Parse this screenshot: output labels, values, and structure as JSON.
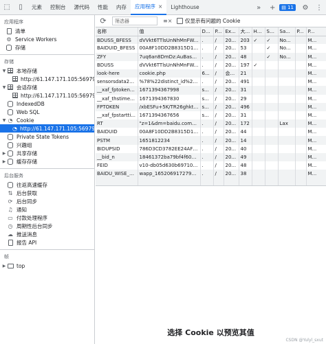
{
  "tabs": [
    {
      "label": "元素"
    },
    {
      "label": "控制台"
    },
    {
      "label": "源代码"
    },
    {
      "label": "性能"
    },
    {
      "label": "内存"
    },
    {
      "label": "应用程序",
      "close": "×"
    },
    {
      "label": "Lighthouse"
    }
  ],
  "toolbar_right": {
    "more_tabs": "»",
    "add": "+",
    "issues_count": "11"
  },
  "sidebar": {
    "app_title": "应用程序",
    "app_items": [
      "清单",
      "Service Workers",
      "存储"
    ],
    "storage_title": "存储",
    "local_storage": "本地存储",
    "local_storage_child": "http://61.147.171.105:56979",
    "session_storage": "会话存储",
    "session_storage_child": "http://61.147.171.105:56979",
    "indexeddb": "IndexedDB",
    "websql": "Web SQL",
    "cookie": "Cookie",
    "cookie_child": "http://61.147.171.105:56979",
    "private_state_tokens": "Private State Tokens",
    "interest_groups": "兴趣组",
    "shared_storage": "共享存储",
    "cache_storage": "缓存存储",
    "bg_title": "后台服务",
    "bg_items": [
      "往返高速缓存",
      "后台获取",
      "后台同步",
      "通知",
      "付款处理程序",
      "周期性后台同步",
      "推送消息",
      "报告 API"
    ],
    "frames_title": "帧",
    "frames_top": "top"
  },
  "toolbar": {
    "filter_placeholder": "筛选器",
    "clear": "≡×",
    "only_issues_label": "仅显示有问题的 Cookie"
  },
  "columns": [
    "名称",
    "值",
    "D...",
    "P...",
    "Ex...",
    "大...",
    "Ht...",
    "Se...",
    "Sa...",
    "P...",
    "P..."
  ],
  "rows": [
    [
      "BDUSS_BFESS",
      "dVVkt6TTlsUnNhMnFW...",
      ".",
      "/",
      "20...",
      "203",
      "✓",
      "✓",
      "No...",
      "",
      "M..."
    ],
    [
      "BAIDUID_BFESS",
      "00A8F10DD2B8315D15...",
      ".",
      "/",
      "20...",
      "53",
      "",
      "✓",
      "No...",
      "",
      "M..."
    ],
    [
      "ZFY",
      "7uq6an8DmDz:AuBasaF...",
      ".",
      "/",
      "20...",
      "48",
      "",
      "✓",
      "No...",
      "",
      "M..."
    ],
    [
      "BDUSS",
      "dVVkt6TTlsUnNhMnFW...",
      ".",
      "/",
      "20...",
      "197",
      "✓",
      "",
      "",
      "",
      "M..."
    ],
    [
      "look-here",
      "cookie.php",
      "6...",
      "/",
      "会...",
      "21",
      "",
      "",
      "",
      "",
      "M..."
    ],
    [
      "sensorsdata20...",
      "%78%22distinct_id%22%...",
      ".",
      "/",
      "20...",
      "491",
      "",
      "",
      "",
      "",
      "M..."
    ],
    [
      "__xaf_fptokenti...",
      "1671394367998",
      "s...",
      "/",
      "20...",
      "31",
      "",
      "",
      "",
      "",
      "M..."
    ],
    [
      "__xaf_thstime_...",
      "1671394367830",
      "s...",
      "/",
      "20...",
      "29",
      "",
      "",
      "",
      "",
      "M..."
    ],
    [
      "FPTOKEN",
      "/xbESFu+5K/TR26ghktV1...",
      "s...",
      "/",
      "20...",
      "496",
      "",
      "",
      "",
      "",
      "M..."
    ],
    [
      "__xaf_fpstartti...",
      "1671394367656",
      "s...",
      "/",
      "20...",
      "31",
      "",
      "",
      "",
      "",
      "M..."
    ],
    [
      "RT",
      "\"z=1&dm=baidu.com&si...",
      ".",
      "/",
      "20...",
      "172",
      "",
      "",
      "Lax",
      "",
      "M..."
    ],
    [
      "BAIDUID",
      "00A8F10DD2B8315D15...",
      ".",
      "/",
      "20...",
      "44",
      "",
      "",
      "",
      "",
      "M..."
    ],
    [
      "PSTM",
      "1651812234",
      ".",
      "/",
      "20...",
      "14",
      "",
      "",
      "",
      "",
      "M..."
    ],
    [
      "BIDUPSID",
      "786D3CD3782EE24AF8...",
      ".",
      "/",
      "20...",
      "40",
      "",
      "",
      "",
      "",
      "M..."
    ],
    [
      "__bid_n",
      "18461372ba79bf4f602...",
      ".",
      "/",
      "20...",
      "49",
      "",
      "",
      "",
      "",
      "M..."
    ],
    [
      "FEID",
      "v10-db05d630b6971000...",
      ".",
      "/",
      "20...",
      "48",
      "",
      "",
      "",
      "",
      "M..."
    ],
    [
      "BAIDU_WISE_U...",
      "wapp_1652069172794_377",
      ".",
      "/",
      "20...",
      "38",
      "",
      "",
      "",
      "",
      "M..."
    ]
  ],
  "preview_text": "选择 Cookie 以预览其值",
  "watermark": "CSDN @Yulyl_sxut"
}
